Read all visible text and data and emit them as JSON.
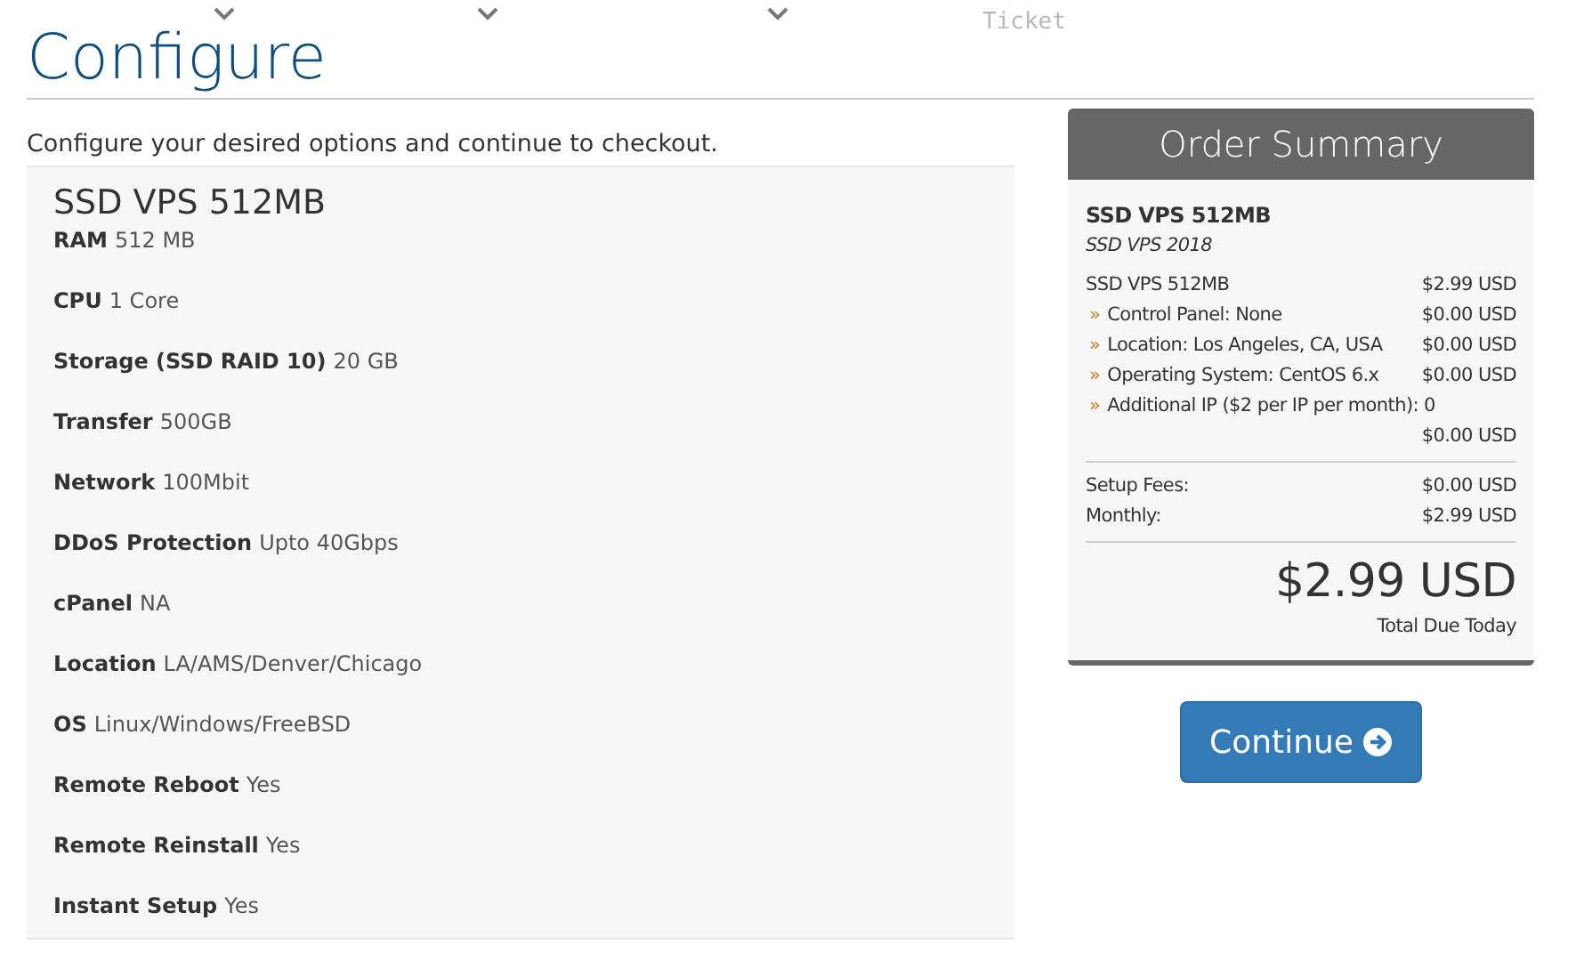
{
  "nav": {
    "faded_label": "Ticket"
  },
  "page": {
    "title": "Configure",
    "intro": "Configure your desired options and continue to checkout."
  },
  "product": {
    "name": "SSD VPS 512MB",
    "specs": [
      {
        "label": "RAM",
        "value": "512 MB"
      },
      {
        "label": "CPU",
        "value": "1 Core"
      },
      {
        "label": "Storage (SSD RAID 10)",
        "value": "20 GB"
      },
      {
        "label": "Transfer",
        "value": "500GB"
      },
      {
        "label": "Network",
        "value": "100Mbit"
      },
      {
        "label": "DDoS Protection",
        "value": "Upto 40Gbps"
      },
      {
        "label": "cPanel",
        "value": "NA"
      },
      {
        "label": "Location",
        "value": "LA/AMS/Denver/Chicago"
      },
      {
        "label": "OS",
        "value": "Linux/Windows/FreeBSD"
      },
      {
        "label": "Remote Reboot",
        "value": "Yes"
      },
      {
        "label": "Remote Reinstall",
        "value": "Yes"
      },
      {
        "label": "Instant Setup",
        "value": "Yes"
      }
    ]
  },
  "order_summary": {
    "title": "Order Summary",
    "product_name": "SSD VPS 512MB",
    "product_group": "SSD VPS 2018",
    "lines": [
      {
        "kind": "main",
        "label": "SSD VPS 512MB",
        "amount": "$2.99 USD"
      },
      {
        "kind": "option",
        "bullet": "»",
        "label": "Control Panel: None",
        "amount": "$0.00 USD"
      },
      {
        "kind": "option",
        "bullet": "»",
        "label": "Location: Los Angeles, CA, USA",
        "amount": "$0.00 USD"
      },
      {
        "kind": "option",
        "bullet": "»",
        "label": "Operating System: CentOS 6.x",
        "amount": "$0.00 USD"
      },
      {
        "kind": "option_wrapped",
        "bullet": "»",
        "label": "Additional IP ($2 per IP per month): 0",
        "amount": "$0.00 USD"
      }
    ],
    "totals": [
      {
        "label": "Setup Fees:",
        "amount": "$0.00 USD"
      },
      {
        "label": "Monthly:",
        "amount": "$2.99 USD"
      }
    ],
    "total": "$2.99 USD",
    "total_caption": "Total Due Today"
  },
  "continue_button": {
    "label": "Continue"
  }
}
